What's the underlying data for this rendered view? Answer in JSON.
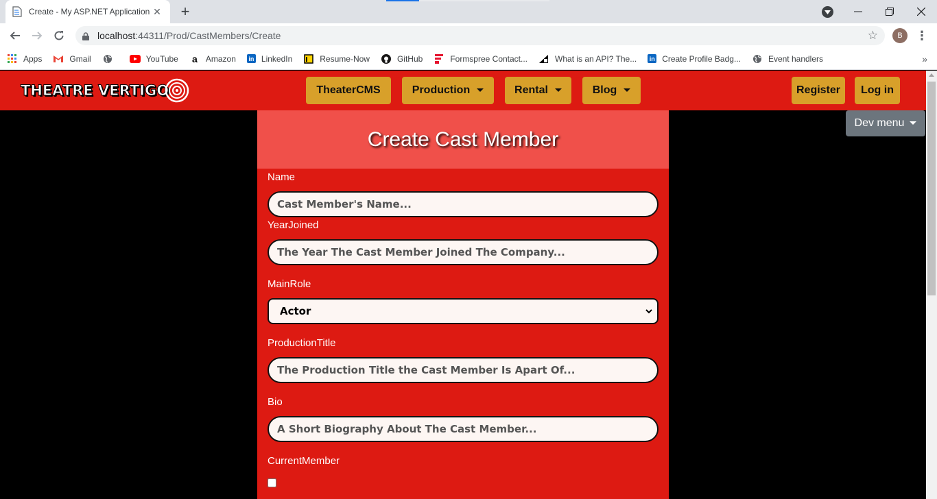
{
  "browser": {
    "tab_title": "Create - My ASP.NET Application",
    "url_host": "localhost",
    "url_rest": ":44311/Prod/CastMembers/Create",
    "profile_initial": "B",
    "bookmarks": [
      {
        "label": "Apps",
        "icon": "apps-grid-icon"
      },
      {
        "label": "Gmail",
        "icon": "gmail-icon"
      },
      {
        "label": "",
        "icon": "globe-icon"
      },
      {
        "label": "YouTube",
        "icon": "youtube-icon"
      },
      {
        "label": "Amazon",
        "icon": "amazon-icon"
      },
      {
        "label": "LinkedIn",
        "icon": "linkedin-icon"
      },
      {
        "label": "Resume-Now",
        "icon": "resume-now-icon"
      },
      {
        "label": "GitHub",
        "icon": "github-icon"
      },
      {
        "label": "Formspree Contact...",
        "icon": "formspree-icon"
      },
      {
        "label": "What is an API? The...",
        "icon": "api-article-icon"
      },
      {
        "label": "Create Profile Badg...",
        "icon": "linkedin-icon"
      },
      {
        "label": "Event handlers",
        "icon": "globe-icon"
      }
    ]
  },
  "navbar": {
    "brand": "THEATRE VERTIGO",
    "items": [
      {
        "label": "TheaterCMS",
        "dropdown": false
      },
      {
        "label": "Production",
        "dropdown": true
      },
      {
        "label": "Rental",
        "dropdown": true
      },
      {
        "label": "Blog",
        "dropdown": true
      }
    ],
    "register_label": "Register",
    "login_label": "Log in",
    "dev_menu_label": "Dev menu"
  },
  "form": {
    "title": "Create Cast Member",
    "name_label": "Name",
    "name_placeholder": "Cast Member's Name...",
    "year_label": "YearJoined",
    "year_placeholder": "The Year The Cast Member Joined The Company...",
    "role_label": "MainRole",
    "role_value": "Actor",
    "production_label": "ProductionTitle",
    "production_placeholder": "The Production Title the Cast Member Is Apart Of...",
    "bio_label": "Bio",
    "bio_placeholder": "A Short Biography About The Cast Member...",
    "current_label": "CurrentMember",
    "current_checked": false
  },
  "colors": {
    "navbar_bg": "#dd1a12",
    "nav_pill": "#d8a02a",
    "card_header": "#f0504a",
    "dev_menu": "#6c757d"
  }
}
